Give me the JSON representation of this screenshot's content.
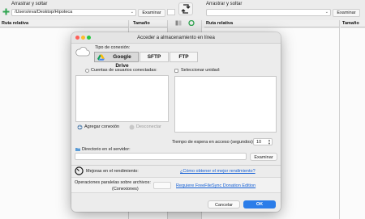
{
  "left_panel": {
    "drag_label": "Arrastrar y soltar",
    "path": "/Users/eva/Desktop/Hipoteca",
    "browse": "Examinar",
    "col_path": "Ruta relativa",
    "col_size": "Tamaño"
  },
  "right_panel": {
    "drag_label": "Arrastrar y soltar",
    "browse": "Examinar",
    "col_path": "Ruta relativa",
    "col_size": "Tamaño"
  },
  "dialog": {
    "title": "Acceder a almacenamiento en línea",
    "connection_type_label": "Tipo de conexión:",
    "tabs": [
      "Google Drive",
      "SFTP",
      "FTP"
    ],
    "connected_users_label": "Cuentas de usuarios conectadas:",
    "select_unit_label": "Seleccionar unidad:",
    "add_connection": "Agregar conexión",
    "disconnect": "Desconectar",
    "timeout_label": "Tiempo de espera en acceso (segundos):",
    "timeout_value": "10",
    "server_dir_label": "Directorio en el servidor:",
    "browse": "Examinar",
    "performance_label": "Mejoras en el rendimiento:",
    "performance_link": "¿Cómo obtener el mejor rendimiento?",
    "parallel_ops_label_1": "Operaciones paralelas sobre archivos:",
    "parallel_ops_label_2": "(Conexiones)",
    "parallel_ops_link": "Requiere FreeFileSync Donation Edition",
    "cancel": "Cancelar",
    "ok": "OK"
  },
  "colors": {
    "accent": "#1a73e8",
    "link": "#1560d6",
    "ok_button": "#2b7de9"
  }
}
